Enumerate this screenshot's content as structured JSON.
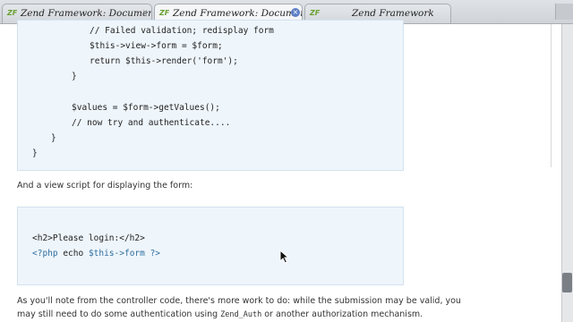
{
  "tabs": [
    {
      "icon": "ZF",
      "title": "Zend Framework: Documentation",
      "close": "×"
    },
    {
      "icon": "ZF",
      "title": "Zend Framework: Documentation",
      "close": "×"
    },
    {
      "icon": "ZF",
      "title": "Zend Framework",
      "close": ""
    }
  ],
  "code_block_1": [
    "// Failed validation; redisplay form",
    "$this->view->form = $form;",
    "return $this->render('form');",
    "}",
    "$values = $form->getValues();",
    "// now try and authenticate....",
    "}",
    "}"
  ],
  "para_view_script": "And a view script for displaying the form:",
  "code_block_2": {
    "line1": "<h2>Please login:</h2>",
    "line2_open": "<?php",
    "line2_echo": " echo ",
    "line2_var": "$this->form",
    "line2_close": " ?>"
  },
  "para_note": {
    "line1": "As you'll note from the controller code, there's more work to do: while the submission may be valid, you",
    "line2_pre": "may still need to do some authentication using ",
    "line2_code": "Zend_Auth",
    "line2_post": " or another authorization mechanism."
  }
}
